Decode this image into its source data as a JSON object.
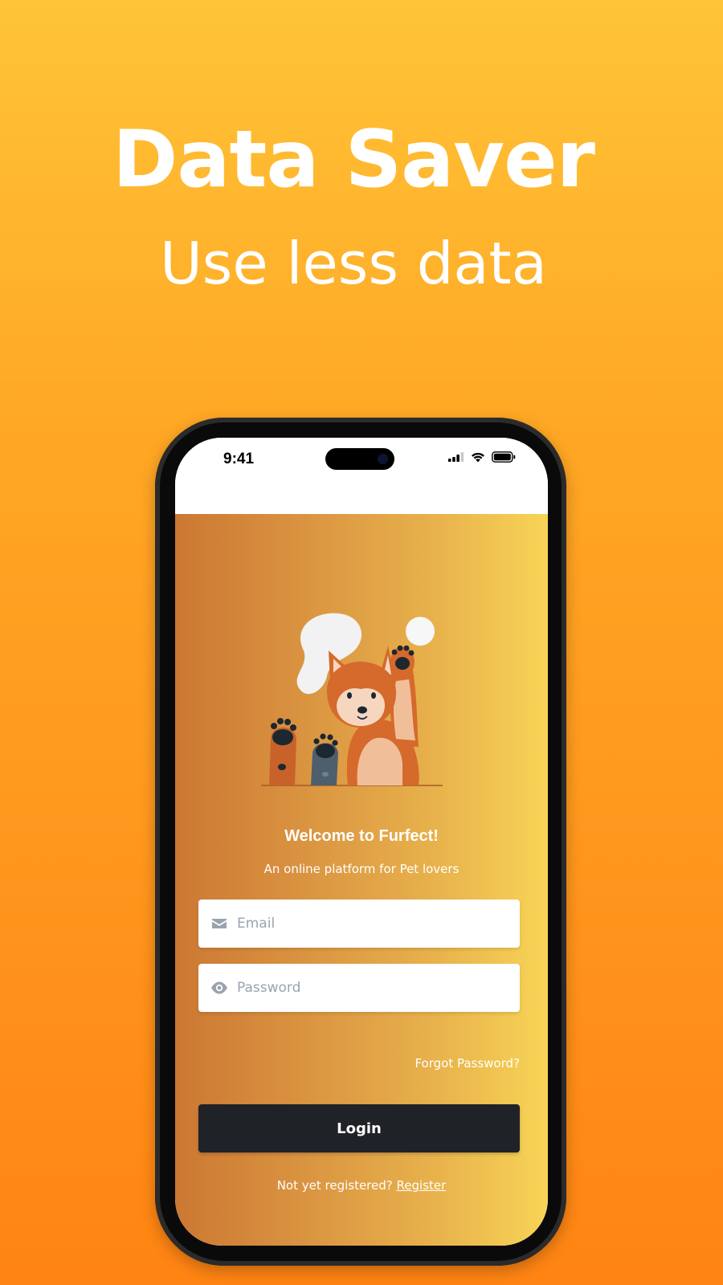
{
  "promo": {
    "headline": "Data Saver",
    "subline": "Use less data"
  },
  "status_bar": {
    "time": "9:41",
    "icons": [
      "cellular-signal-icon",
      "wifi-icon",
      "battery-icon"
    ]
  },
  "app": {
    "welcome_title": "Welcome to Furfect!",
    "tagline": "An online platform for Pet lovers",
    "email": {
      "placeholder": "Email",
      "value": "",
      "icon": "envelope-icon"
    },
    "password": {
      "placeholder": "Password",
      "value": "",
      "icon": "eye-icon"
    },
    "forgot_password_label": "Forgot Password?",
    "login_label": "Login",
    "register_prompt": "Not yet registered?",
    "register_link_label": "Register"
  },
  "colors": {
    "background_top": "#ffc437",
    "background_bottom": "#ff8412",
    "app_gradient_left": "#cc7833",
    "app_gradient_right": "#f8d456",
    "login_button": "#1f2226",
    "input_background": "#ffffff"
  }
}
